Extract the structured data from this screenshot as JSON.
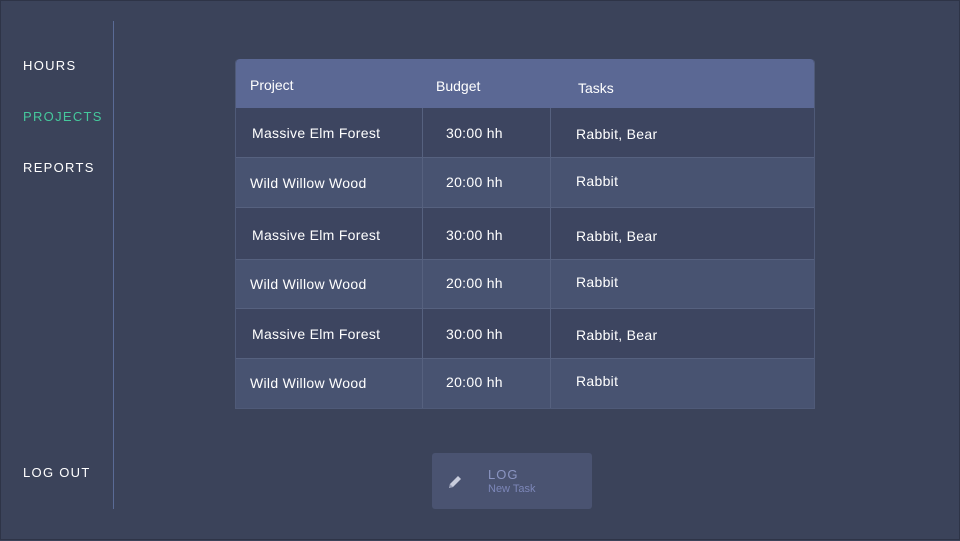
{
  "sidebar": {
    "items": [
      {
        "label": "HOURS"
      },
      {
        "label": "PROJECTS"
      },
      {
        "label": "REPORTS"
      }
    ],
    "logout_label": "LOG OUT"
  },
  "table": {
    "headers": [
      "Project",
      "Budget",
      "Tasks"
    ],
    "rows": [
      {
        "project": "Massive Elm Forest",
        "budget": "30:00 hh",
        "tasks": "Rabbit, Bear"
      },
      {
        "project": "Wild Willow Wood",
        "budget": "20:00 hh",
        "tasks": "Rabbit"
      },
      {
        "project": "Massive Elm Forest",
        "budget": "30:00 hh",
        "tasks": "Rabbit, Bear"
      },
      {
        "project": "Wild Willow Wood",
        "budget": "20:00 hh",
        "tasks": "Rabbit"
      },
      {
        "project": "Massive Elm Forest",
        "budget": "30:00 hh",
        "tasks": "Rabbit, Bear"
      },
      {
        "project": "Wild Willow Wood",
        "budget": "20:00 hh",
        "tasks": "Rabbit"
      }
    ]
  },
  "log_button": {
    "title": "LOG",
    "subtitle": "New Task",
    "icon": "pencil-icon"
  },
  "colors": {
    "background": "#3b435a",
    "accent": "#45c89c",
    "table_header": "#5b6894"
  }
}
